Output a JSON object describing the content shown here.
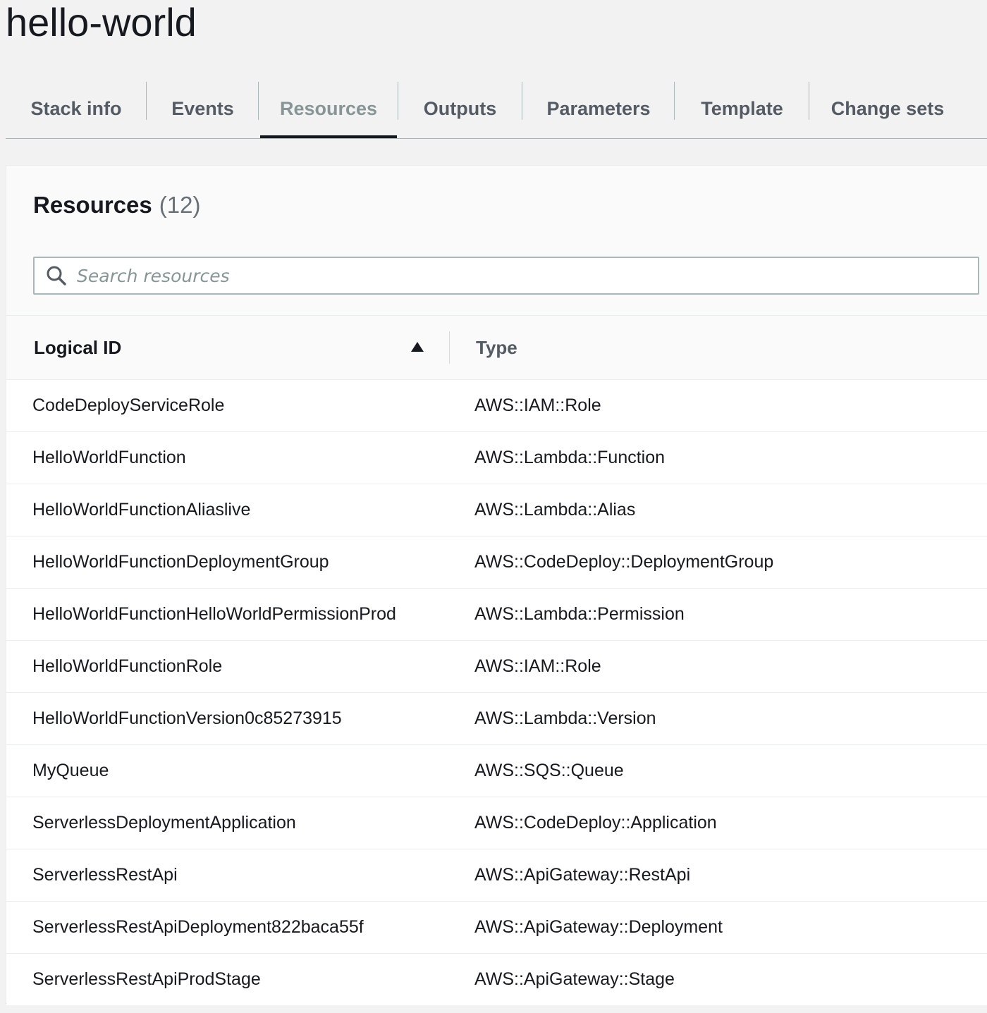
{
  "stack": {
    "name": "hello-world"
  },
  "tabs": [
    {
      "label": "Stack info",
      "active": false
    },
    {
      "label": "Events",
      "active": false
    },
    {
      "label": "Resources",
      "active": true
    },
    {
      "label": "Outputs",
      "active": false
    },
    {
      "label": "Parameters",
      "active": false
    },
    {
      "label": "Template",
      "active": false
    },
    {
      "label": "Change sets",
      "active": false
    }
  ],
  "resources": {
    "title": "Resources",
    "count": "(12)",
    "search": {
      "placeholder": "Search resources",
      "value": "",
      "icon": "search-icon"
    },
    "columns": {
      "logical_id": "Logical ID",
      "type": "Type",
      "sort_icon": "sort-ascending-icon"
    },
    "rows": [
      {
        "logical_id": "CodeDeployServiceRole",
        "type": "AWS::IAM::Role"
      },
      {
        "logical_id": "HelloWorldFunction",
        "type": "AWS::Lambda::Function"
      },
      {
        "logical_id": "HelloWorldFunctionAliaslive",
        "type": "AWS::Lambda::Alias"
      },
      {
        "logical_id": "HelloWorldFunctionDeploymentGroup",
        "type": "AWS::CodeDeploy::DeploymentGroup"
      },
      {
        "logical_id": "HelloWorldFunctionHelloWorldPermissionProd",
        "type": "AWS::Lambda::Permission"
      },
      {
        "logical_id": "HelloWorldFunctionRole",
        "type": "AWS::IAM::Role"
      },
      {
        "logical_id": "HelloWorldFunctionVersion0c85273915",
        "type": "AWS::Lambda::Version"
      },
      {
        "logical_id": "MyQueue",
        "type": "AWS::SQS::Queue"
      },
      {
        "logical_id": "ServerlessDeploymentApplication",
        "type": "AWS::CodeDeploy::Application"
      },
      {
        "logical_id": "ServerlessRestApi",
        "type": "AWS::ApiGateway::RestApi"
      },
      {
        "logical_id": "ServerlessRestApiDeployment822baca55f",
        "type": "AWS::ApiGateway::Deployment"
      },
      {
        "logical_id": "ServerlessRestApiProdStage",
        "type": "AWS::ApiGateway::Stage"
      }
    ]
  },
  "colors": {
    "active_tab_underline": "#16191f",
    "active_tab_text": "#879596",
    "inactive_tab_text": "#545b64"
  }
}
